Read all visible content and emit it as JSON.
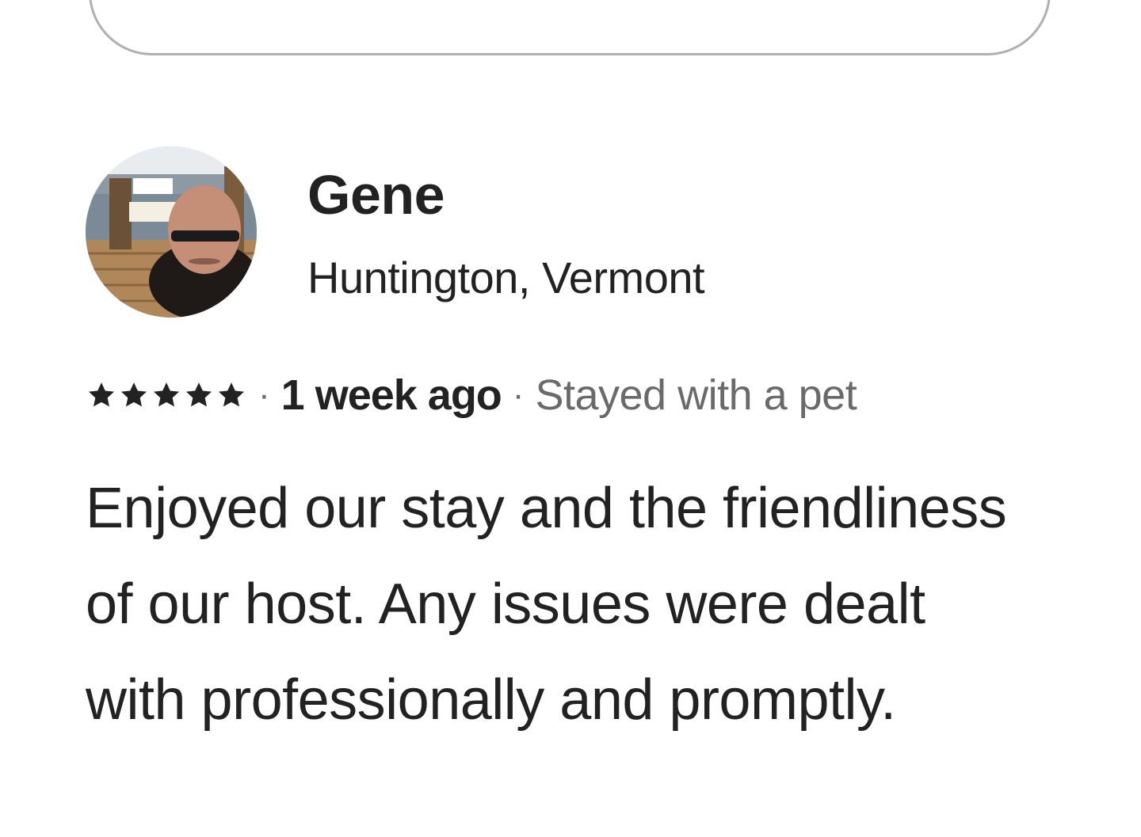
{
  "search": {
    "icon": "search-icon"
  },
  "review": {
    "reviewer": {
      "name": "Gene",
      "location": "Huntington, Vermont",
      "avatar_icon": "avatar"
    },
    "rating": {
      "value": 5,
      "max": 5,
      "icon": "star-icon"
    },
    "separator": "·",
    "date": "1 week ago",
    "stay_tag": "Stayed with a pet",
    "text": "Enjoyed our stay and the friendliness of our host. Any issues were dealt with professionally and promptly."
  },
  "colors": {
    "text_primary": "#222222",
    "text_secondary": "#6a6a6a",
    "border": "#b0b0b0"
  }
}
